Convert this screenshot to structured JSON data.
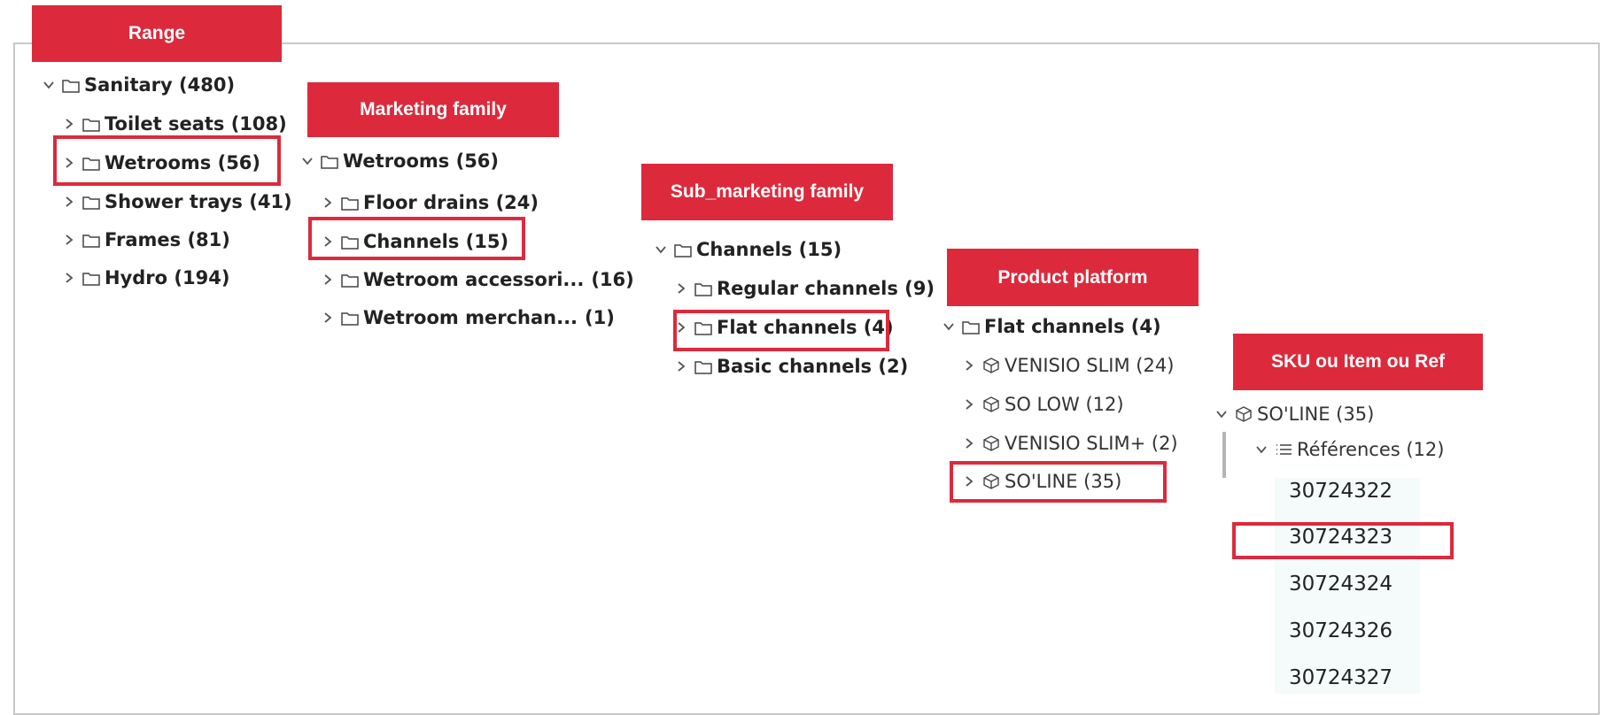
{
  "headers": {
    "range": "Range",
    "marketing_family": "Marketing family",
    "sub_marketing_family": "Sub_marketing family",
    "product_platform": "Product platform",
    "sku": "SKU ou Item ou Ref"
  },
  "range_tree": {
    "root": "Sanitary (480)",
    "items": [
      "Toilet seats (108)",
      "Wetrooms (56)",
      "Shower trays (41)",
      "Frames (81)",
      "Hydro (194)"
    ]
  },
  "marketing_tree": {
    "root": "Wetrooms (56)",
    "items": [
      {
        "label": "Floor drains (24)",
        "count": ""
      },
      {
        "label": "Channels (15)",
        "count": ""
      },
      {
        "label": "Wetroom accessori...",
        "count": "(16)"
      },
      {
        "label": "Wetroom merchan...",
        "count": "(1)"
      }
    ]
  },
  "sub_marketing_tree": {
    "root": "Channels (15)",
    "items": [
      "Regular channels (9)",
      "Flat channels (4)",
      "Basic channels (2)"
    ]
  },
  "platform_tree": {
    "root": "Flat channels (4)",
    "items": [
      "VENISIO SLIM (24)",
      "SO LOW (12)",
      "VENISIO SLIM+ (2)",
      "SO'LINE (35)"
    ]
  },
  "sku_tree": {
    "root": "SO'LINE (35)",
    "group": "Références (12)",
    "refs": [
      "30724322",
      "30724323",
      "30724324",
      "30724326",
      "30724327"
    ]
  },
  "colors": {
    "accent": "#dc2a3c",
    "border": "#c8c8c8"
  },
  "icons": [
    "chevron-right-icon",
    "chevron-down-icon",
    "folder-icon",
    "cube-icon",
    "list-icon"
  ]
}
